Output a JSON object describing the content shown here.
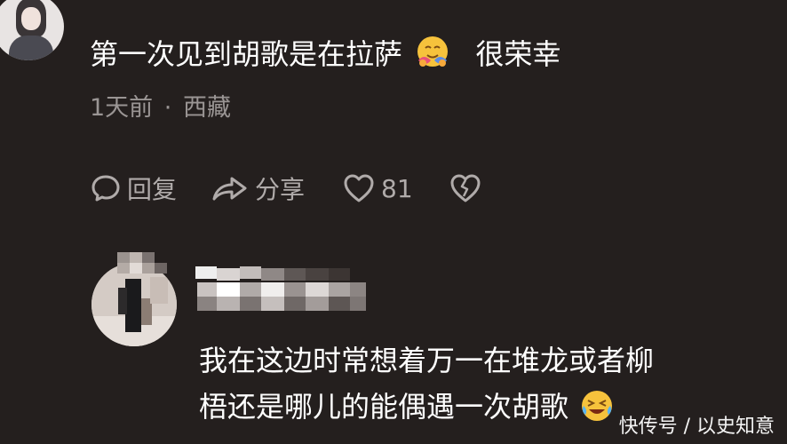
{
  "comment": {
    "text_before_emoji": "第一次见到胡歌是在拉萨",
    "emoji_name": "smiling-face-with-hearts-hug-emoji",
    "text_after_emoji": "很荣幸",
    "time": "1天前",
    "separator": "·",
    "location": "西藏"
  },
  "actions": {
    "reply_label": "回复",
    "share_label": "分享",
    "like_count": "81"
  },
  "reply": {
    "line1": "我在这边时常想着万一在堆龙或者柳",
    "line2": "梧还是哪儿的能偶遇一次胡歌",
    "emoji_name": "crying-laughing-emoji"
  },
  "watermark": {
    "text": "快传号 / 以史知意"
  },
  "colors": {
    "background": "#241f1e",
    "text_primary": "#ffffff",
    "text_secondary": "#9a9594",
    "icon": "#b0abaa"
  }
}
